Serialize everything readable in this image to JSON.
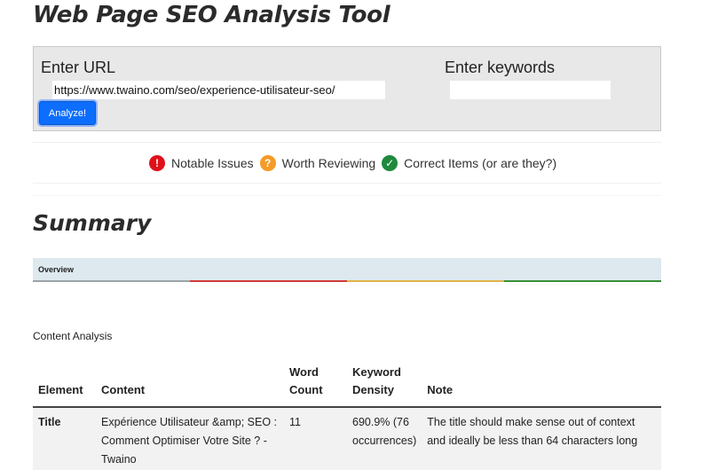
{
  "app": {
    "title": "Web Page SEO Analysis Tool"
  },
  "form": {
    "url_label": "Enter URL",
    "url_value": "https://www.twaino.com/seo/experience-utilisateur-seo/",
    "keywords_label": "Enter keywords",
    "keywords_value": "",
    "analyze_label": "Analyze!"
  },
  "legend": {
    "notable_issues": "Notable Issues",
    "worth_reviewing": "Worth Reviewing",
    "correct_items": "Correct Items (or are they?)",
    "icons": {
      "red": "!",
      "orange": "?",
      "green": "✓"
    },
    "colors": {
      "red": "#e0101a",
      "orange": "#f59b26",
      "green": "#1f8a3b"
    }
  },
  "summary": {
    "title": "Summary",
    "overview_label": "Overview"
  },
  "content_analysis": {
    "title": "Content Analysis",
    "headers": {
      "element": "Element",
      "content": "Content",
      "word_count": "Word Count",
      "keyword_density": "Keyword Density",
      "note": "Note"
    },
    "rows": [
      {
        "element": "Title",
        "content": "Expérience Utilisateur &amp; SEO : Comment Optimiser Votre Site ? - Twaino",
        "word_count": "11",
        "keyword_density": "690.9% (76 occurrences)",
        "note": "The title should make sense out of context and ideally be less than 64 characters long"
      }
    ]
  }
}
